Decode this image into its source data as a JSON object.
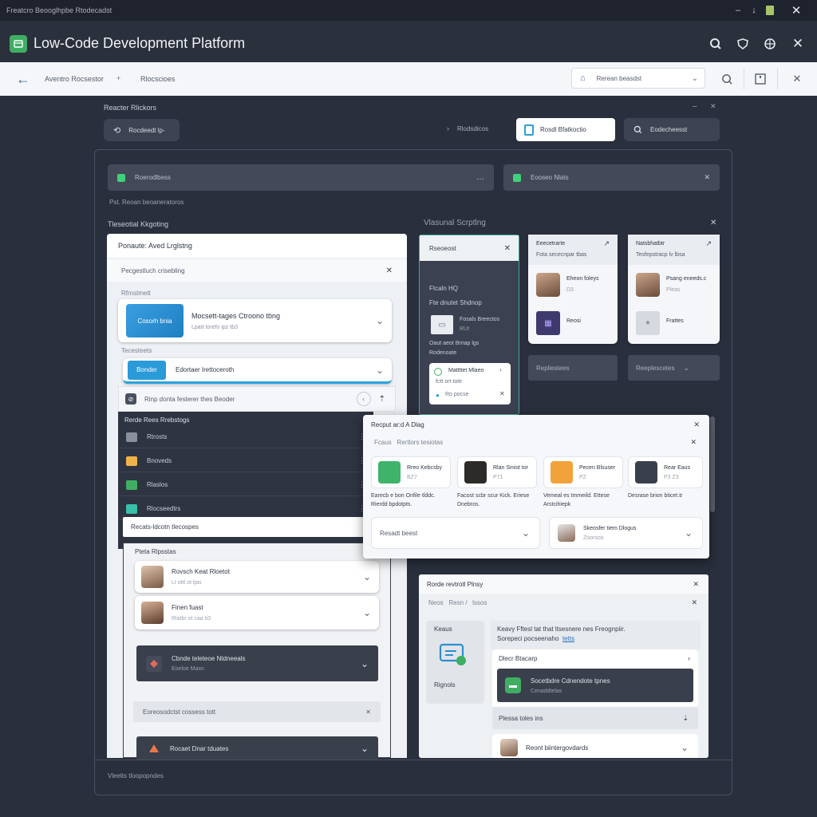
{
  "titlebar": {
    "title": "Freatcro Beooglhpbe Rtodecadst"
  },
  "app": {
    "title": "Low-Code Development Platform"
  },
  "nav": {
    "crumb1": "Aventro Rocsestor",
    "crumb2": "Rlocscioes",
    "search_value": "Rerean beasdst"
  },
  "toolbar": {
    "heading": "Reacter Rlickors",
    "button1": "Rocdeedt lp-",
    "filter_label": "Rlodsdicos",
    "active_tab": "Rosdl Bfatkoctio",
    "button3": "Eodecheesst"
  },
  "topbar": {
    "field1": "Roerodlbess",
    "field2": "Eooseo Nlats"
  },
  "hint": "Pst. Reoan beoaneratoros",
  "section": {
    "left_label": "Tleseotial Kkgoting",
    "right_label": "Vlasunal Scrptlng"
  },
  "left_panel": {
    "header": "Ponaute: Aved Lrglstng",
    "sub": "Pecgestluch crisebling",
    "group1": "Rfrnstmett",
    "item1_button": "Cosorh bnia",
    "item1_title": "Mocsett-tages Ctroono tbng",
    "item1_meta": "Lpatt torefo ipz tb3",
    "group2": "Tecesteets",
    "item2_button": "Bonder",
    "item2_title": "Edortaer Irettoceroth",
    "search_text": "Rinp donta festerer thes Beoder"
  },
  "dark_list": {
    "header": "Rerde Rees Rrebstogs",
    "items": [
      "Rtrosts",
      "Bnoveds",
      "Rlaslos",
      "Rlocseedtrs"
    ],
    "footer": "Recats-ldcotn tlecospes"
  },
  "people_panel": {
    "header": "Pteta Rlpsstas",
    "p1_name": "Rovsch Keat Rloetot",
    "p1_meta": "Lt ottl ot tjas",
    "p2_name": "Finen fuast",
    "p2_meta": "Rlatbr ot caa ti3",
    "dark1_title": "Cbnde teleteoe Ntdneeals",
    "dark1_meta": "Eoeloe Maxn",
    "bar_text": "Eoreosodctst cossess tott",
    "dark2_title": "Rocaet Dnar tduates"
  },
  "mid_panel": {
    "header": "Rseoeost",
    "label1": "Ftcaln HQ",
    "label2": "Fte dnutet Shdnop",
    "file_title": "Fosals Breectos",
    "file_meta": "RUt",
    "caption1": "Oaut aeot Brnap lgs",
    "caption2": "Rodenoate",
    "popup_title": "Mattttet Mlaeo",
    "popup_meta": "fctt ort tote",
    "popup_foot": "Ro pocse"
  },
  "mini_cards": [
    {
      "title": "Eeecetrarte",
      "sub": "Fota sececnpar tbas",
      "person": "Eheon foleys",
      "person_meta": "D3",
      "item2": "Reosi"
    },
    {
      "title": "Natsbhatbtr",
      "sub": "Tesfepstracp lv lbsa",
      "person": "Psang eneeds.c",
      "person_meta": "Pleas",
      "item2": "Frattes"
    }
  ],
  "mini_footer": {
    "left": "Repliestees",
    "right": "Reeplescetes"
  },
  "dialog": {
    "title": "Recput ar:d A Dlag",
    "tabs": "Fcaus   Rertlors tesiotas",
    "cards": [
      {
        "name": "Rreo Kebcsby",
        "meta": "BZ7",
        "desc": "Earecb e bon Onfile tlddc. Rierdd bpdotpts.",
        "color": "#3fb36a"
      },
      {
        "name": "Rlan Smist tor",
        "meta": "P71",
        "desc": "Facost scbr scur Kick. Eriese Dnebros.",
        "color": "#2d2a2a"
      },
      {
        "name": "Pecen Blsuser",
        "meta": "PZ",
        "desc": "Vemeal es tmmeild. Ettese Arstcihiepk",
        "color": "#f2a23a"
      },
      {
        "name": "Rear Eaus",
        "meta": "P3 Z3",
        "desc": "Desrase brion bticet.tr",
        "color": "#3a3f4c"
      }
    ],
    "select1": "Resadt beest",
    "select2_name": "Skeosfer tiem Dlogus",
    "select2_meta": "Zoorsoo"
  },
  "lower_dialog": {
    "title": "Rorde revtrotl Plnsy",
    "tabs": "Neos   Resn /   lssos",
    "side_label1": "Keaus",
    "side_label2": "Rignols",
    "note_line1": "Keavy Fftesl tat that ltsesnere nes Freognpiir.",
    "note_line2": "Sorepeci pocseenaho",
    "note_link": "tetts",
    "field1": "Dlecr Btacarp",
    "tile_title": "Socetbdre Cdnendote tpnes",
    "tile_meta": "Cenaddtelas",
    "field2": "Plessa toles ins",
    "person": "Reont biintergovdards"
  },
  "statusbar": "Vleelts tloopopndes"
}
